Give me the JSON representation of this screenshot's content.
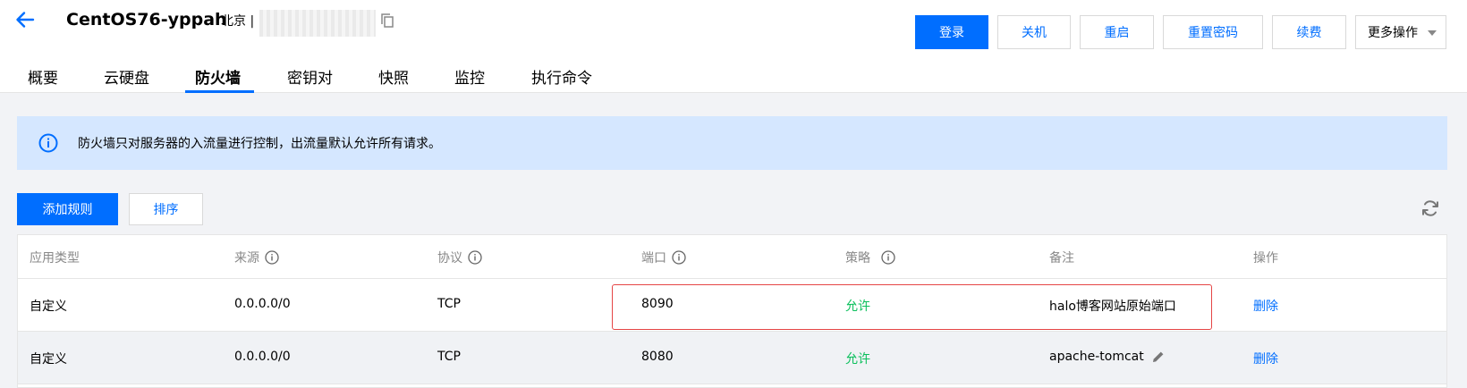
{
  "header": {
    "title": "CentOS76-yppah",
    "region": "北京 |",
    "ip_address_masked": ""
  },
  "actions": {
    "login": "登录",
    "shutdown": "关机",
    "restart": "重启",
    "reset_password": "重置密码",
    "renew": "续费",
    "more": "更多操作"
  },
  "tabs": [
    "概要",
    "云硬盘",
    "防火墙",
    "密钥对",
    "快照",
    "监控",
    "执行命令"
  ],
  "active_tab": "防火墙",
  "banner": {
    "message": "防火墙只对服务器的入流量进行控制，出流量默认允许所有请求。"
  },
  "toolbar": {
    "add_rule": "添加规则",
    "sort": "排序"
  },
  "table": {
    "columns": [
      "应用类型",
      "来源",
      "协议",
      "端口",
      "策略",
      "备注",
      "操作"
    ],
    "rows": [
      {
        "app_type": "自定义",
        "source": "0.0.0.0/0",
        "protocol": "TCP",
        "port": "8090",
        "policy": "允许",
        "remark": "halo博客网站原始端口",
        "action": "删除"
      },
      {
        "app_type": "自定义",
        "source": "0.0.0.0/0",
        "protocol": "TCP",
        "port": "8080",
        "policy": "允许",
        "remark": "apache-tomcat",
        "action": "删除"
      }
    ]
  },
  "colors": {
    "accent": "#006eff",
    "allow": "#0abf5b",
    "banner_bg": "#d5e7ff",
    "highlight_border": "#e54545"
  }
}
